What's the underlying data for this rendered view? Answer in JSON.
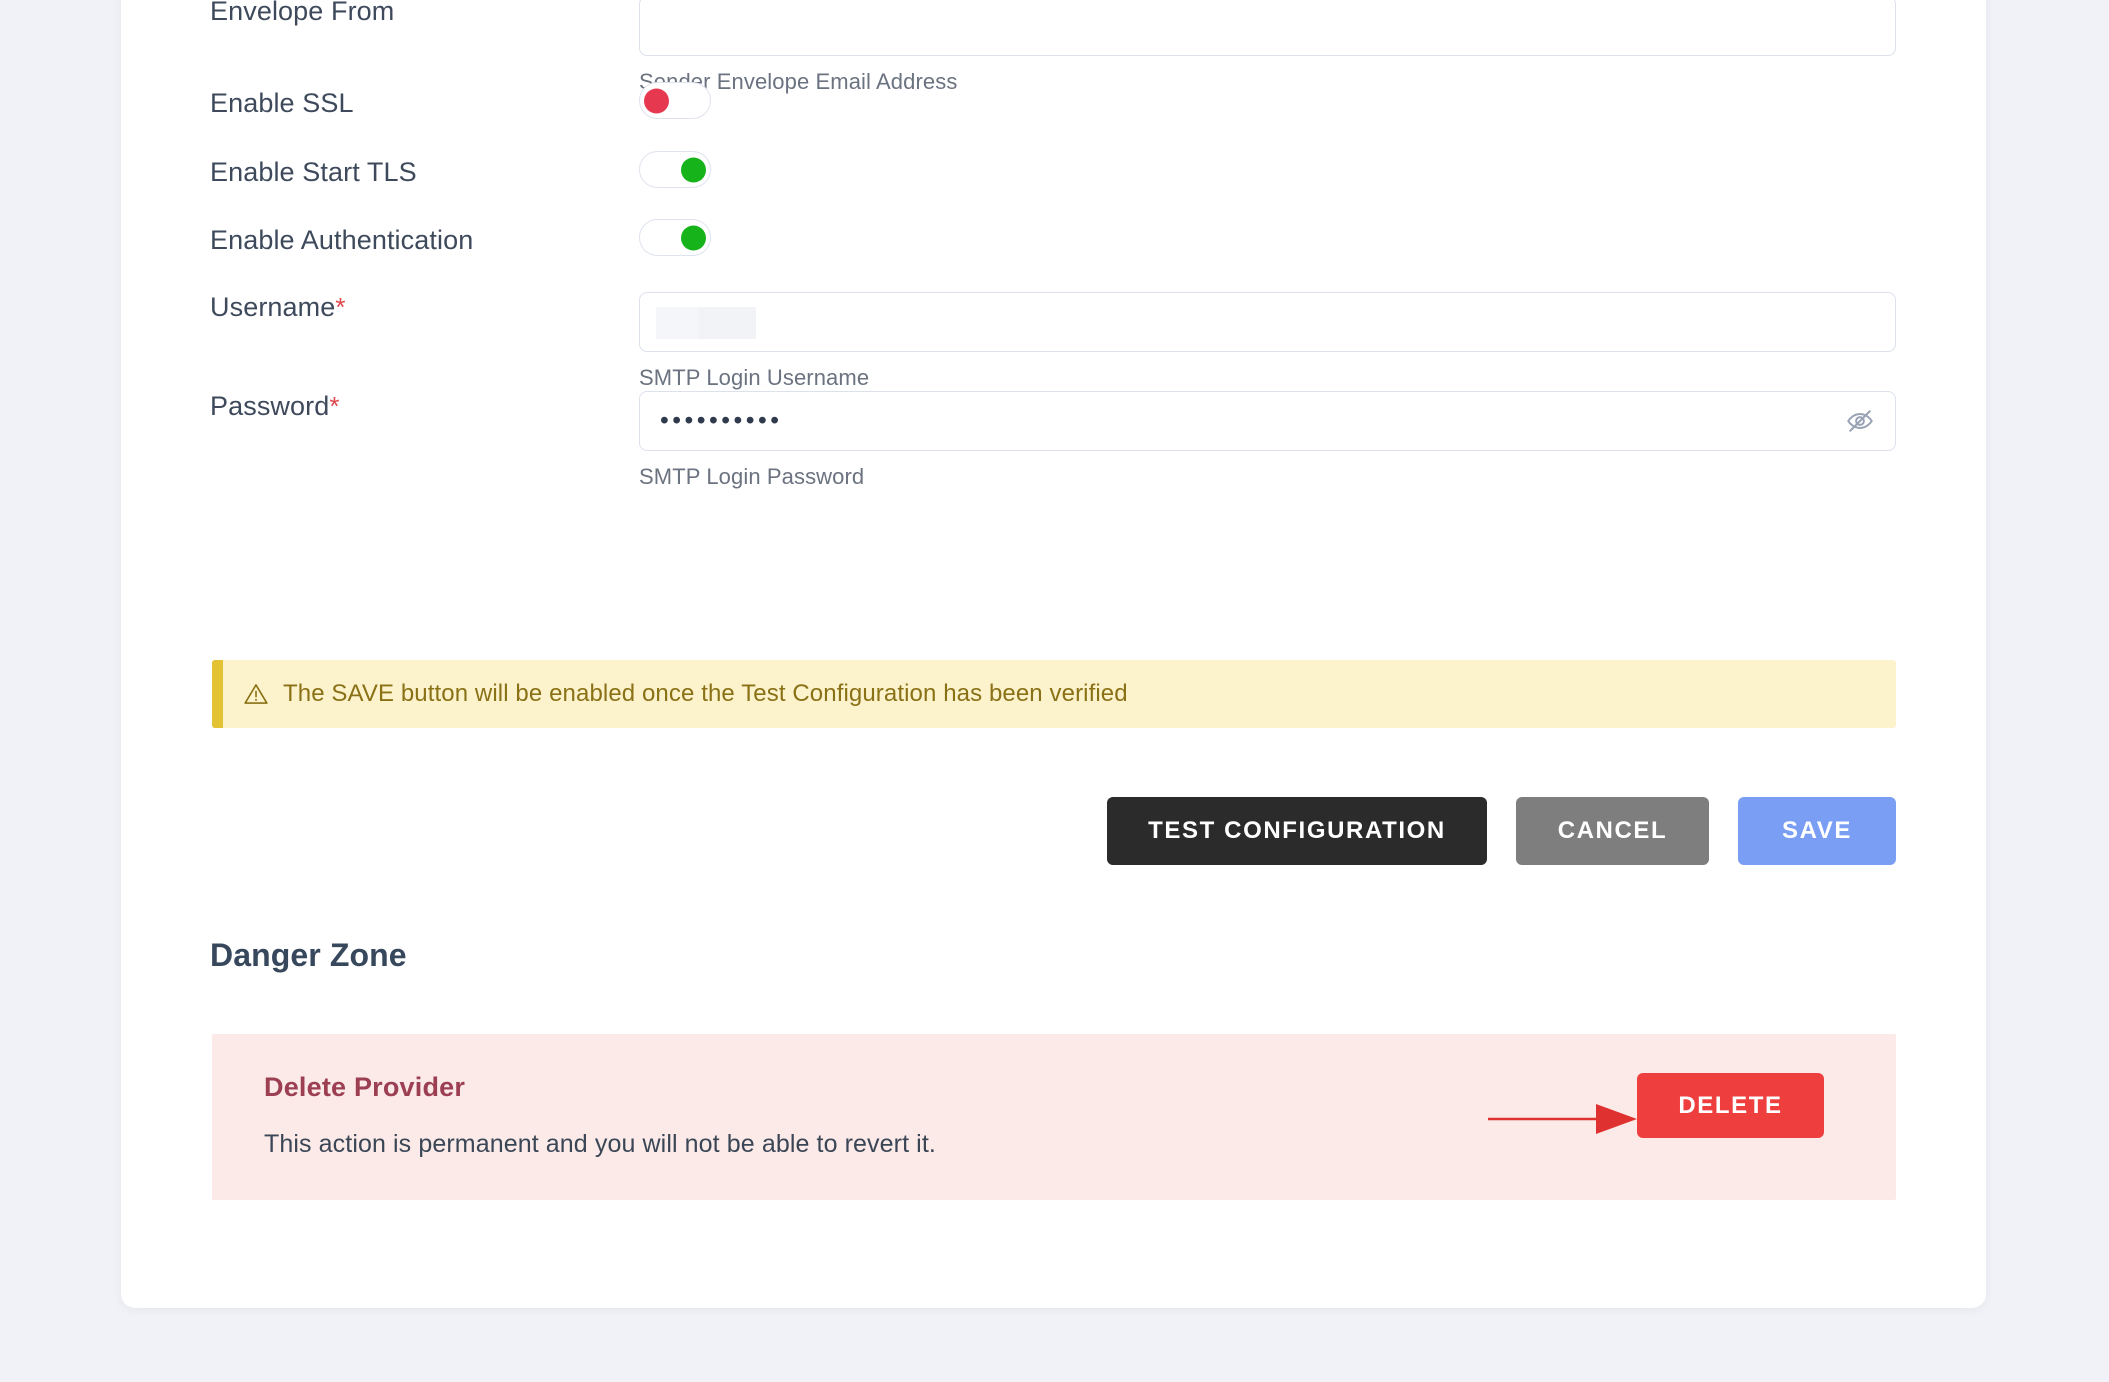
{
  "form": {
    "fields": [
      {
        "label": "Envelope From",
        "required": false,
        "value": "",
        "hint": "Sender Envelope Email Address",
        "type": "text"
      },
      {
        "label": "Enable SSL",
        "type": "toggle",
        "state": "off",
        "knob_color": "#e63950"
      },
      {
        "label": "Enable Start TLS",
        "type": "toggle",
        "state": "on",
        "knob_color": "#16b31a"
      },
      {
        "label": "Enable Authentication",
        "type": "toggle",
        "state": "on",
        "knob_color": "#16b31a"
      },
      {
        "label": "Username",
        "required": true,
        "required_marker": "*",
        "value": "",
        "value_redacted": true,
        "hint": "SMTP Login Username",
        "type": "text"
      },
      {
        "label": "Password",
        "required": true,
        "required_marker": "*",
        "value": "••••••••••",
        "hint": "SMTP Login Password",
        "type": "password",
        "reveal_icon": "eye-off-icon"
      }
    ]
  },
  "notice": {
    "icon": "warning-triangle-icon",
    "text": "The SAVE button will be enabled once the Test Configuration has been verified",
    "background": "#fcf3cd",
    "accent": "#e3c233",
    "text_color": "#8a7116"
  },
  "actions": {
    "test_label": "TEST CONFIGURATION",
    "cancel_label": "CANCEL",
    "save_label": "SAVE",
    "test_color": "#2b2b2b",
    "cancel_color": "#7e7e7e",
    "save_color": "#7a9ef4"
  },
  "danger_zone": {
    "title": "Danger Zone",
    "heading": "Delete Provider",
    "description": "This action is permanent and you will not be able to revert it.",
    "delete_label": "DELETE",
    "panel_color": "#fbeae7",
    "heading_color": "#9c3f53",
    "delete_color": "#ef3e3e"
  },
  "annotation": {
    "type": "arrow",
    "color": "#e03131",
    "points_to": "DELETE"
  }
}
